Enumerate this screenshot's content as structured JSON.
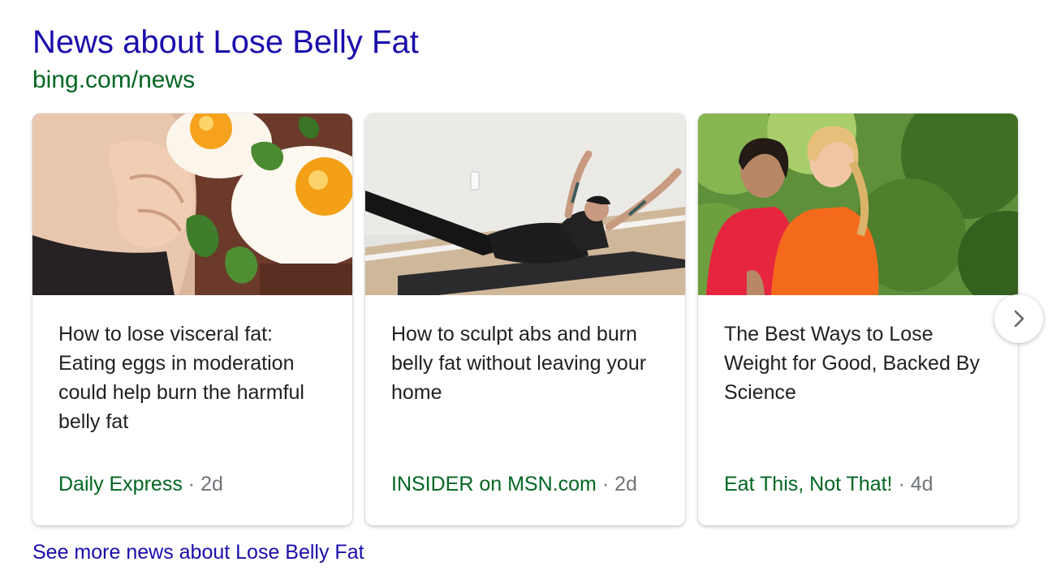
{
  "header": {
    "title": "News about Lose Belly Fat",
    "source_url": "bing.com/news"
  },
  "articles": [
    {
      "headline": "How to lose visceral fat: Eating eggs in moderation could help burn the harmful belly fat",
      "source": "Daily Express",
      "separator": "·",
      "age": "2d",
      "image": "eggs-belly-photo"
    },
    {
      "headline": "How to sculpt abs and burn belly fat without leaving your home",
      "source": "INSIDER on MSN.com",
      "separator": "·",
      "age": "2d",
      "image": "man-ab-exercise-photo"
    },
    {
      "headline": "The Best Ways to Lose Weight for Good, Backed By Science",
      "source": "Eat This, Not That!",
      "separator": "·",
      "age": "4d",
      "image": "women-walking-photo"
    }
  ],
  "carousel": {
    "next_icon": "chevron-right-icon"
  },
  "footer": {
    "see_more": "See more news about Lose Belly Fat"
  },
  "colors": {
    "link": "#1a0dab",
    "url_green": "#006621",
    "text": "#202124",
    "muted": "#70757a"
  }
}
